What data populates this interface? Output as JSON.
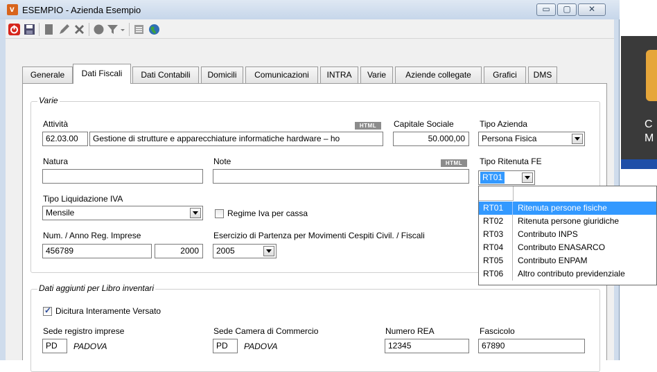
{
  "window": {
    "title": "ESEMPIO - Azienda Esempio",
    "min_glyph": "▭",
    "max_glyph": "▢",
    "close_glyph": "✕"
  },
  "background_app": {
    "text_line1": "C",
    "text_line2": "M"
  },
  "toolbar": {
    "icons": [
      "power-icon",
      "save-icon",
      "new-icon",
      "edit-icon",
      "delete-icon",
      "circle-icon",
      "filter-icon",
      "report-icon",
      "web-icon"
    ]
  },
  "tabs": [
    "Generale",
    "Dati Fiscali",
    "Dati Contabili",
    "Domicili",
    "Comunicazioni",
    "INTRA",
    "Varie",
    "Aziende collegate",
    "Grafici",
    "DMS"
  ],
  "active_tab": "Dati Fiscali",
  "varie": {
    "legend": "Varie",
    "attivita_label": "Attività",
    "attivita_code": "62.03.00",
    "attivita_desc": "Gestione di strutture e apparecchiature informatiche hardware – ho",
    "html_badge": "HTML",
    "capitale_label": "Capitale Sociale",
    "capitale_value": "50.000,00",
    "tipo_azienda_label": "Tipo Azienda",
    "tipo_azienda_value": "Persona Fisica",
    "natura_label": "Natura",
    "natura_value": "",
    "note_label": "Note",
    "note_value": "",
    "tipo_ritenuta_label": "Tipo Ritenuta FE",
    "tipo_ritenuta_value": "RT01",
    "tipo_liq_label": "Tipo Liquidazione IVA",
    "tipo_liq_value": "Mensile",
    "regime_label": "Regime Iva per cassa",
    "regime_checked": false,
    "num_anno_label": "Num. / Anno Reg. Imprese",
    "num_value": "456789",
    "anno_value": "2000",
    "esercizio_label": "Esercizio di Partenza per Movimenti Cespiti Civil. / Fiscali",
    "esercizio_value": "2005"
  },
  "dropdown": {
    "items": [
      {
        "code": "RT01",
        "desc": "Ritenuta persone fisiche",
        "selected": true
      },
      {
        "code": "RT02",
        "desc": "Ritenuta persone giuridiche",
        "selected": false
      },
      {
        "code": "RT03",
        "desc": "Contributo INPS",
        "selected": false
      },
      {
        "code": "RT04",
        "desc": "Contributo ENASARCO",
        "selected": false
      },
      {
        "code": "RT05",
        "desc": "Contributo ENPAM",
        "selected": false
      },
      {
        "code": "RT06",
        "desc": "Altro contributo previdenziale",
        "selected": false
      }
    ]
  },
  "inventari": {
    "legend": "Dati aggiunti per Libro inventari",
    "dicitura_label": "Dicitura Interamente Versato",
    "dicitura_checked": true,
    "sede_registro_label": "Sede registro imprese",
    "sede_registro_code": "PD",
    "sede_registro_name": "PADOVA",
    "sede_camera_label": "Sede Camera di Commercio",
    "sede_camera_code": "PD",
    "sede_camera_name": "PADOVA",
    "rea_label": "Numero REA",
    "rea_value": "12345",
    "fascicolo_label": "Fascicolo",
    "fascicolo_value": "67890"
  }
}
